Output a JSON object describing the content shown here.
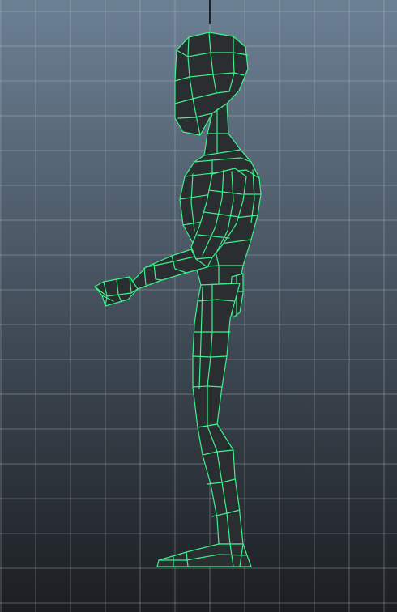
{
  "viewport": {
    "view": "side",
    "background_top": "#6c8094",
    "background_bottom": "#1b1e22",
    "grid_line_color": "#c8ccd0",
    "axis_line_color": "#000000"
  },
  "model": {
    "shading": "smooth-shaded-with-wireframe",
    "mesh_fill": "#2b2e31",
    "wireframe_color": "#3cf08c",
    "selected": true
  }
}
